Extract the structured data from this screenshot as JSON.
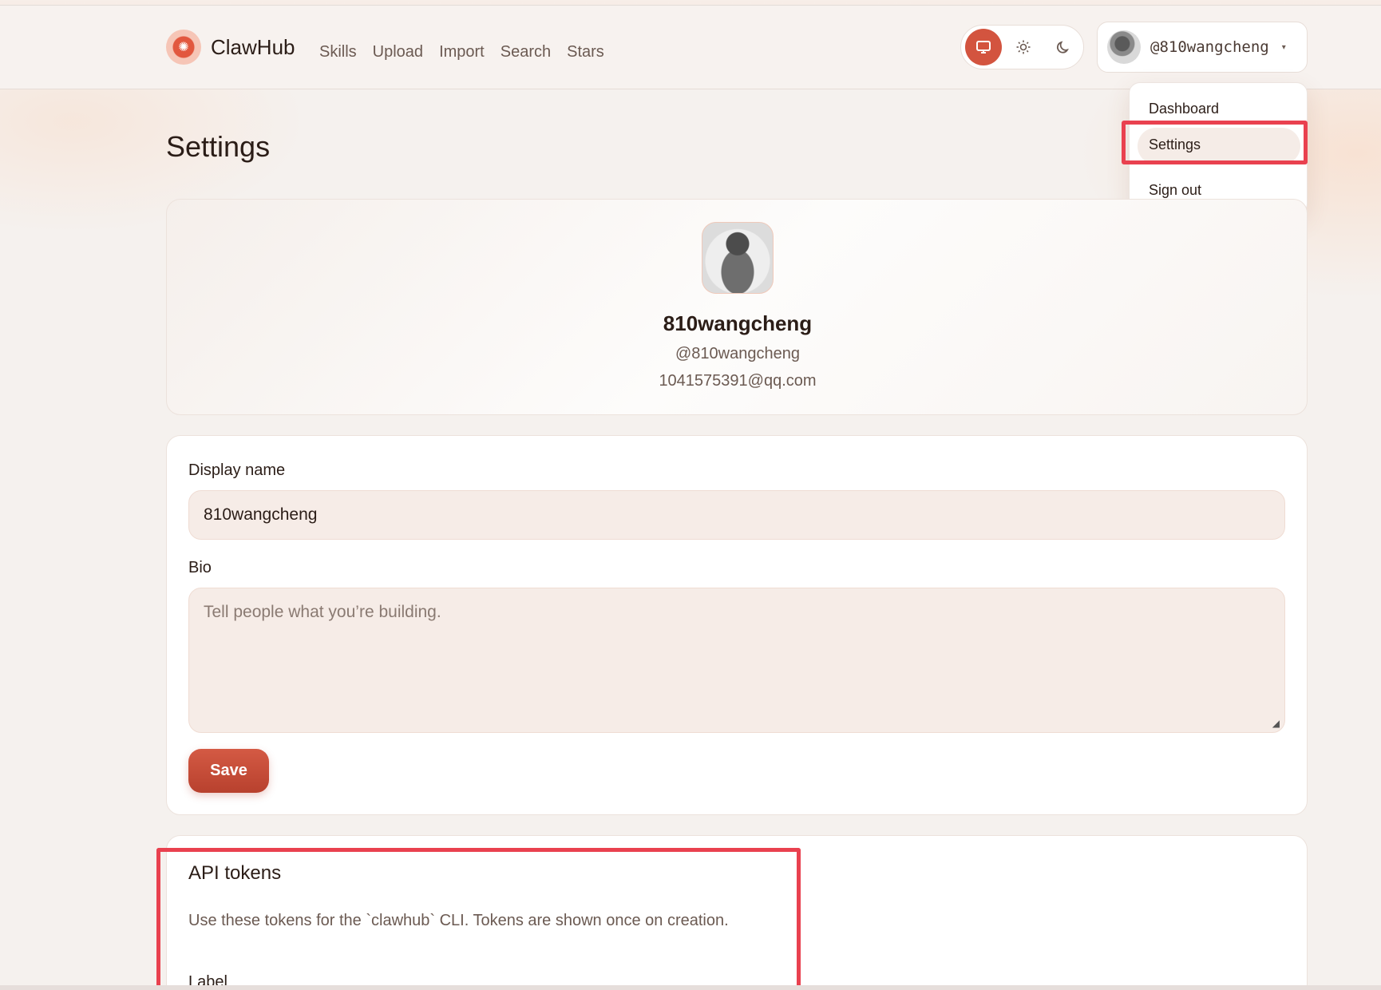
{
  "brand": {
    "name": "ClawHub",
    "logo_icon": "lobster-claw-icon"
  },
  "nav": {
    "items": [
      "Skills",
      "Upload",
      "Import",
      "Search",
      "Stars"
    ]
  },
  "theme_toggle": {
    "options": [
      "system",
      "light",
      "dark"
    ],
    "selected": "system",
    "accent": "#d3543f"
  },
  "user_menu": {
    "handle": "@810wangcheng",
    "caret": "▾",
    "dropdown": {
      "items": [
        "Dashboard",
        "Settings",
        "Sign out"
      ],
      "highlighted": "Settings"
    }
  },
  "page": {
    "title": "Settings"
  },
  "profile": {
    "display_name": "810wangcheng",
    "handle": "@810wangcheng",
    "email": "1041575391@qq.com"
  },
  "form": {
    "display_name_label": "Display name",
    "display_name_value": "810wangcheng",
    "bio_label": "Bio",
    "bio_placeholder": "Tell people what you’re building.",
    "save_label": "Save"
  },
  "api_tokens": {
    "title": "API tokens",
    "description": "Use these tokens for the `clawhub` CLI. Tokens are shown once on creation.",
    "label_heading": "Label"
  },
  "annotation_color": "#e9414f"
}
